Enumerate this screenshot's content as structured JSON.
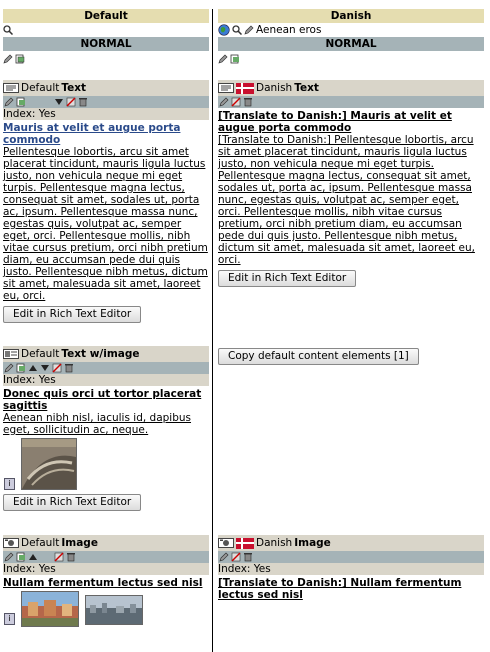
{
  "left": {
    "header": "Default",
    "section": "NORMAL",
    "elements": [
      {
        "head_prefix": "Default",
        "head_type": "Text",
        "index": "Index: Yes",
        "title": "Mauris at velit et augue porta commodo",
        "body": "Pellentesque lobortis, arcu sit amet placerat tincidunt, mauris ligula luctus justo, non vehicula neque mi eget turpis. Pellentesque magna lectus, consequat sit amet, sodales ut, porta ac, ipsum. Pellentesque massa nunc, egestas quis, volutpat ac, semper eget, orci. Pellentesque mollis, nibh vitae cursus pretium, orci nibh pretium diam, eu accumsan pede dui quis justo. Pellentesque nibh metus, dictum sit amet, malesuada sit amet, laoreet eu, orci.",
        "button": "Edit in Rich Text Editor"
      },
      {
        "head_prefix": "Default",
        "head_type": "Text w/image",
        "index": "Index: Yes",
        "title": "Donec quis orci ut tortor placerat sagittis",
        "body": "Aenean nibh nisl, iaculis id, dapibus eget, sollicitudin ac, neque.",
        "button": "Edit in Rich Text Editor"
      },
      {
        "head_prefix": "Default",
        "head_type": "Image",
        "index": "Index: Yes",
        "title": "Nullam fermentum lectus sed nisl"
      }
    ]
  },
  "right": {
    "header": "Danish",
    "page_title": "Aenean eros",
    "section": "NORMAL",
    "elements": [
      {
        "head_type": "Text",
        "head_lang": "Danish",
        "title": "[Translate to Danish:] Mauris at velit et augue porta commodo",
        "body": "[Translate to Danish:] Pellentesque lobortis, arcu sit amet placerat tincidunt, mauris ligula luctus justo, non vehicula neque mi eget turpis. Pellentesque magna lectus, consequat sit amet, sodales ut, porta ac, ipsum. Pellentesque massa nunc, egestas quis, volutpat ac, semper eget, orci. Pellentesque mollis, nibh vitae cursus pretium, orci nibh pretium diam, eu accumsan pede dui quis justo. Pellentesque nibh metus, dictum sit amet, malesuada sit amet, laoreet eu, orci.",
        "button": "Edit in Rich Text Editor"
      },
      {
        "copy_button": "Copy default content elements [1]"
      },
      {
        "head_type": "Image",
        "head_lang": "Danish",
        "index": "Index: Yes",
        "title": "[Translate to Danish:] Nullam fermentum lectus sed nisl"
      }
    ]
  },
  "icons": {
    "flag": "danish-flag-icon",
    "info": "info-icon",
    "zoom": "magnifier-icon"
  }
}
